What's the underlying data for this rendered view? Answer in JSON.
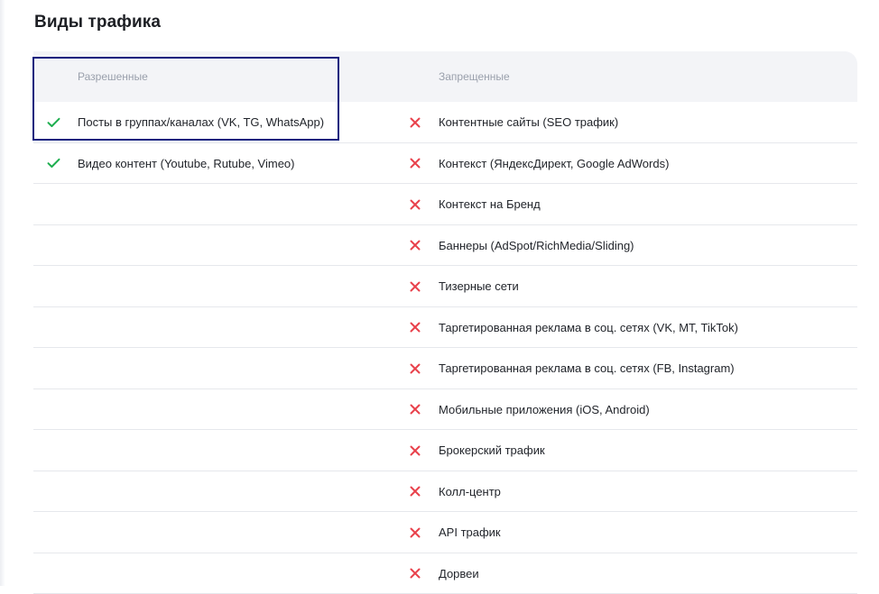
{
  "title": "Виды трафика",
  "headers": {
    "allowed": "Разрешенные",
    "forbidden": "Запрещенные"
  },
  "colors": {
    "allowed_icon": "#1eae4f",
    "forbidden_icon": "#e8414b",
    "highlight_border": "#0f1d7e",
    "header_bg": "#f3f4f7"
  },
  "icons": {
    "allowed": "check-icon",
    "forbidden": "cross-icon"
  },
  "rows": [
    {
      "allowed": "Посты в группах/каналах (VK, TG, WhatsApp)",
      "forbidden": "Контентные сайты (SEO трафик)"
    },
    {
      "allowed": "Видео контент (Youtube, Rutube, Vimeo)",
      "forbidden": "Контекст (ЯндексДирект, Google AdWords)"
    },
    {
      "allowed": "",
      "forbidden": "Контекст на Бренд"
    },
    {
      "allowed": "",
      "forbidden": "Баннеры (AdSpot/RichMedia/Sliding)"
    },
    {
      "allowed": "",
      "forbidden": "Тизерные сети"
    },
    {
      "allowed": "",
      "forbidden": "Таргетированная реклама в соц. сетях (VK, MT, TikTok)"
    },
    {
      "allowed": "",
      "forbidden": "Таргетированная реклама в соц. сетях (FB, Instagram)"
    },
    {
      "allowed": "",
      "forbidden": "Мобильные приложения (iOS, Android)"
    },
    {
      "allowed": "",
      "forbidden": "Брокерский трафик"
    },
    {
      "allowed": "",
      "forbidden": "Колл-центр"
    },
    {
      "allowed": "",
      "forbidden": "API трафик"
    },
    {
      "allowed": "",
      "forbidden": "Дорвеи"
    }
  ]
}
